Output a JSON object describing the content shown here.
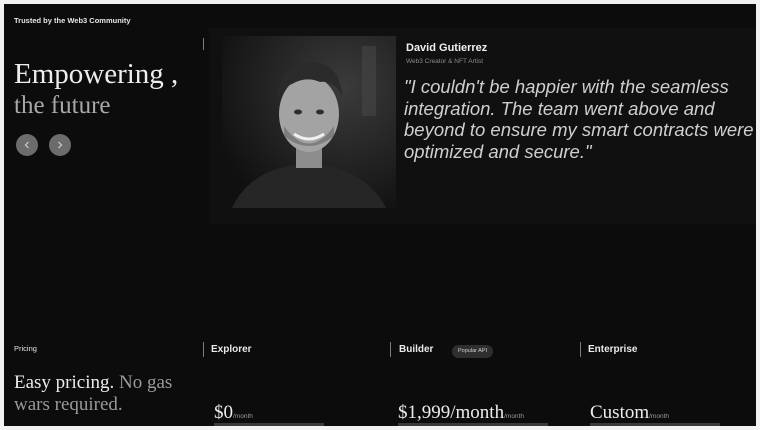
{
  "hero": {
    "tagline": "Trusted by the Web3 Community",
    "headline_line1": "Empowering ,",
    "headline_line2": "the future",
    "prev_icon": "chevron-left-icon",
    "next_icon": "chevron-right-icon"
  },
  "testimonial": {
    "author_name": "David Gutierrez",
    "author_role": "Web3 Creator & NFT Artist",
    "quote": "\"I couldn't be happier with the seamless integration. The team went above and beyond to ensure my smart contracts were optimized and secure.\""
  },
  "pricing": {
    "label": "Pricing",
    "headline_main": "Easy pricing.",
    "headline_sub": " No gas wars required.",
    "plans": [
      {
        "name": "Explorer",
        "price": "$0",
        "period": "/month"
      },
      {
        "name": "Builder",
        "badge": "Popular API",
        "price": "$1,999/month",
        "period": "/month"
      },
      {
        "name": "Enterprise",
        "price": "Custom",
        "period": "/month"
      }
    ]
  },
  "colors": {
    "background": "#0c0c0d",
    "text": "#ededed",
    "muted": "#9a9a9a"
  }
}
